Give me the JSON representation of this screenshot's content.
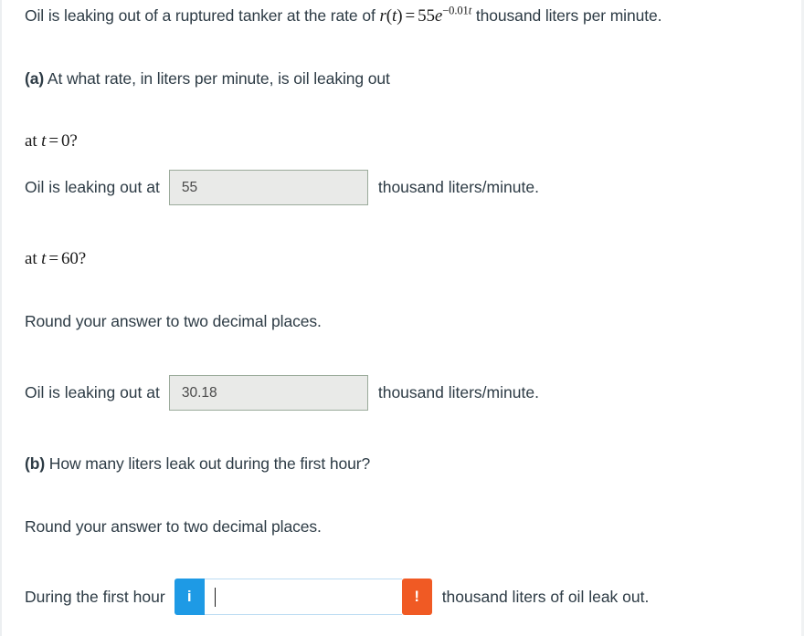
{
  "problem": {
    "statement_pre": "Oil is leaking out of a ruptured tanker at the rate of ",
    "formula": {
      "func": "r",
      "var": "t",
      "equals": "=",
      "coefficient": "55",
      "base": "e",
      "exponent": "−0.01",
      "exponent_var": "t",
      "plain": "r(t) = 55e^(-0.01t)"
    },
    "statement_post": " thousand liters per minute."
  },
  "part_a": {
    "marker": "(a)",
    "question": " At what rate, in liters per minute, is oil leaking out",
    "sub_q1": {
      "prefix": "at ",
      "var": "t",
      "equals": "=",
      "value": "0?",
      "plain": "at t = 0?"
    },
    "answer1": {
      "pre_label": "Oil is leaking out at",
      "value": "55",
      "post_label": "thousand liters/minute.",
      "state": "disabled"
    },
    "sub_q2": {
      "prefix": "at ",
      "var": "t",
      "equals": "=",
      "value": "60?",
      "plain": "at t = 60?"
    },
    "rounding_note": "Round your answer to two decimal places.",
    "answer2": {
      "pre_label": "Oil is leaking out at",
      "value": "30.18",
      "post_label": "thousand liters/minute.",
      "state": "disabled"
    }
  },
  "part_b": {
    "marker": "(b)",
    "question": " How many liters leak out during the first hour?",
    "rounding_note": "Round your answer to two decimal places.",
    "answer": {
      "pre_label": "During the first hour",
      "info_badge": "i",
      "value": "",
      "placeholder": "",
      "alert_badge": "!",
      "post_label": "thousand liters of oil leak out.",
      "state": "focused"
    }
  },
  "colors": {
    "info_blue": "#1e9ae5",
    "alert_orange": "#f05a24",
    "text": "#2d3b45",
    "disabled_field_bg": "#e9eae8",
    "disabled_field_border": "#9bab9b",
    "focus_border": "#bcdcf2"
  }
}
